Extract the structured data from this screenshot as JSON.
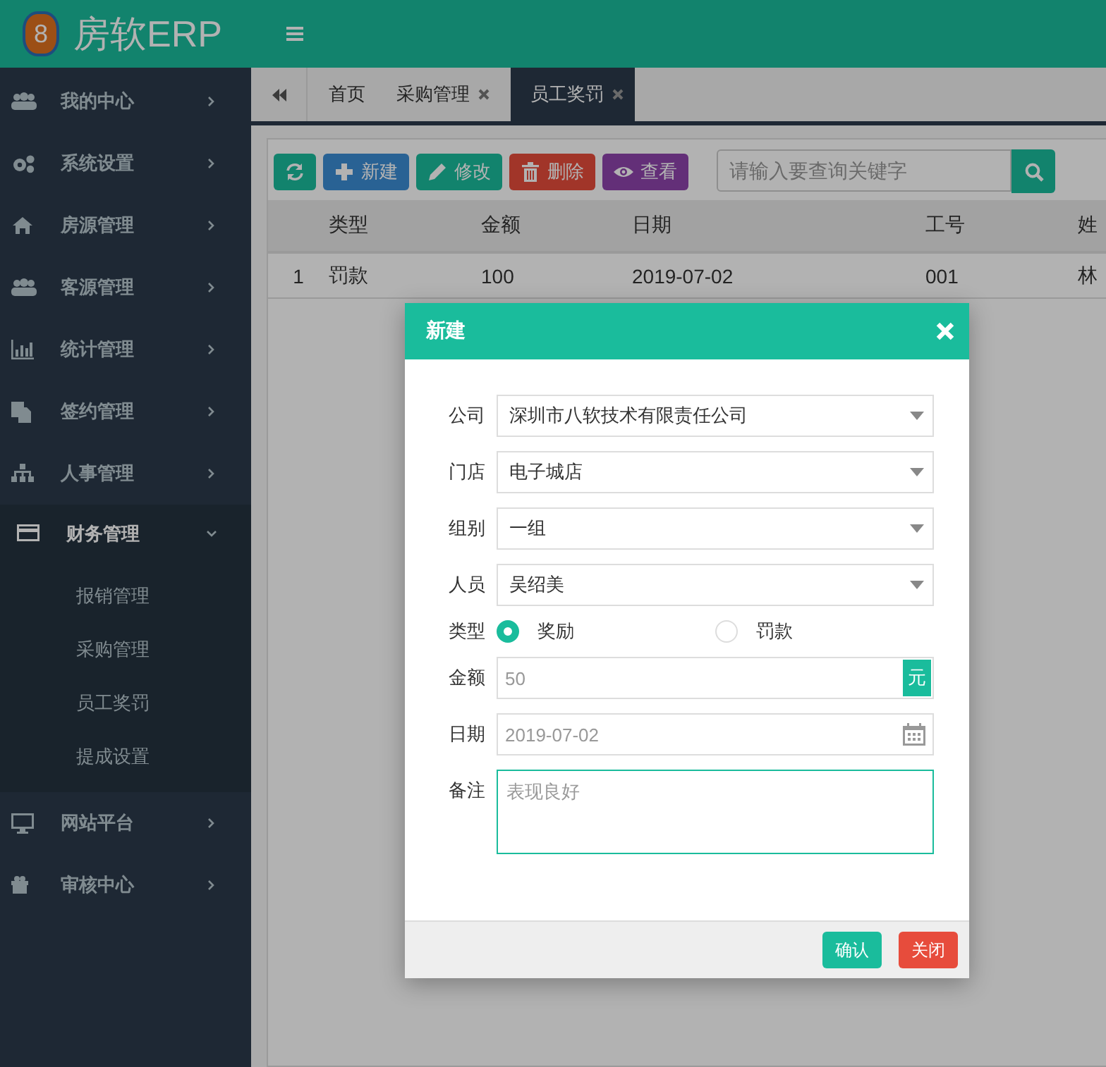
{
  "app": {
    "logo": "8",
    "title": "房软ERP"
  },
  "sidebar": {
    "items": [
      {
        "label": "我的中心",
        "expanded": false
      },
      {
        "label": "系统设置",
        "expanded": false
      },
      {
        "label": "房源管理",
        "expanded": false
      },
      {
        "label": "客源管理",
        "expanded": false
      },
      {
        "label": "统计管理",
        "expanded": false
      },
      {
        "label": "签约管理",
        "expanded": false
      },
      {
        "label": "人事管理",
        "expanded": false
      },
      {
        "label": "财务管理",
        "expanded": true,
        "children": [
          {
            "label": "报销管理"
          },
          {
            "label": "采购管理"
          },
          {
            "label": "员工奖罚"
          },
          {
            "label": "提成设置"
          }
        ]
      },
      {
        "label": "网站平台",
        "expanded": false
      },
      {
        "label": "审核中心",
        "expanded": false
      }
    ]
  },
  "tabs": [
    {
      "label": "首页",
      "selected": false,
      "closable": false
    },
    {
      "label": "采购管理",
      "selected": false,
      "closable": true
    },
    {
      "label": "员工奖罚",
      "selected": true,
      "closable": true
    }
  ],
  "toolbar": {
    "buttons": [
      {
        "kind": "refresh"
      },
      {
        "kind": "new",
        "label": "新建"
      },
      {
        "kind": "edit",
        "label": "修改"
      },
      {
        "kind": "delete",
        "label": "删除"
      },
      {
        "kind": "view",
        "label": "查看"
      }
    ],
    "search": {
      "placeholder": "请输入要查询关键字"
    }
  },
  "table": {
    "columns": [
      "",
      "类型",
      "金额",
      "日期",
      "工号",
      "姓"
    ],
    "rows": [
      [
        "1",
        "罚款",
        "100",
        "2019-07-02",
        "001",
        "林"
      ]
    ]
  },
  "dialog": {
    "title": "新建",
    "fields": [
      {
        "kind": "select",
        "label": "公司",
        "value": "深圳市八软技术有限责任公司"
      },
      {
        "kind": "select",
        "label": "门店",
        "value": "电子城店"
      },
      {
        "kind": "select",
        "label": "组别",
        "value": "一组"
      },
      {
        "kind": "select",
        "label": "人员",
        "value": "吴绍美"
      },
      {
        "kind": "radio",
        "label": "类型",
        "options": [
          {
            "label": "奖励",
            "selected": true
          },
          {
            "label": "罚款",
            "selected": false
          }
        ]
      },
      {
        "kind": "amount",
        "label": "金额",
        "placeholder": "50",
        "unit": "元"
      },
      {
        "kind": "date",
        "label": "日期",
        "placeholder": "2019-07-02"
      },
      {
        "kind": "textarea",
        "label": "备注",
        "placeholder": "表现良好",
        "focused": true
      }
    ],
    "buttons": [
      {
        "kind": "confirm",
        "label": "确认"
      },
      {
        "kind": "close",
        "label": "关闭"
      }
    ]
  }
}
